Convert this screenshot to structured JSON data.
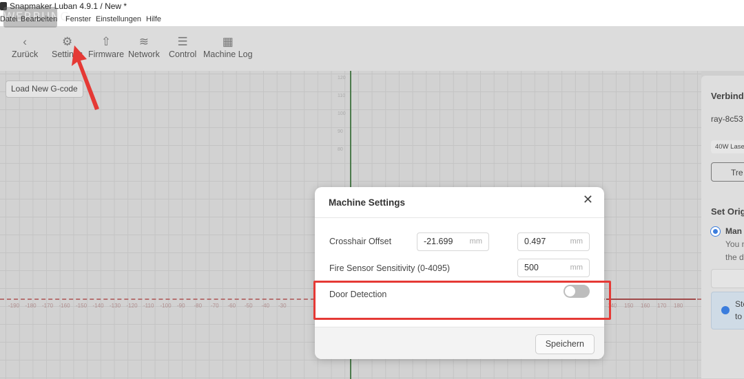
{
  "window": {
    "title": "Snapmaker Luban 4.9.1 / New *"
  },
  "menu": [
    "Datei",
    "Bearbeiten",
    "Fenster",
    "Einstellungen",
    "Hilfe"
  ],
  "watermark": "WERBUNG",
  "toolbar": [
    {
      "label": "Zurück",
      "icon": "chevron-left-icon",
      "glyph": "‹"
    },
    {
      "label": "Settings",
      "icon": "machine-settings-icon",
      "glyph": "⚙"
    },
    {
      "label": "Firmware",
      "icon": "firmware-upload-icon",
      "glyph": "⇧"
    },
    {
      "label": "Network",
      "icon": "wifi-icon",
      "glyph": "≋"
    },
    {
      "label": "Control",
      "icon": "sliders-icon",
      "glyph": "☰"
    },
    {
      "label": "Machine Log",
      "icon": "log-icon",
      "glyph": "▦"
    }
  ],
  "canvas": {
    "load_button": "Load New G-code",
    "x_ticks_left": [
      "-190",
      "-180",
      "-170",
      "-160",
      "-150",
      "-140",
      "-130",
      "-120",
      "-110",
      "-100",
      "-90",
      "-80",
      "-70",
      "-60",
      "-50",
      "-40",
      "-30"
    ],
    "x_ticks_right": [
      "140",
      "150",
      "160",
      "170",
      "180"
    ],
    "y_ticks": [
      "120",
      "110",
      "100",
      "90",
      "80"
    ],
    "axis_colors": {
      "x": "#a04848",
      "y": "#4c7a4c"
    }
  },
  "right_panel": {
    "connection_title": "Verbind",
    "device": "ray-8c53",
    "badge": "40W Lase",
    "disconnect_button": "Tre",
    "origin_title": "Set Orig",
    "radio_label": "Man",
    "radio_desc1": "You n",
    "radio_desc2": "the d",
    "info1": "Ste",
    "info2": "to"
  },
  "modal": {
    "title": "Machine Settings",
    "crosshair_label": "Crosshair Offset",
    "crosshair_x": "-21.699",
    "crosshair_y": "0.497",
    "unit": "mm",
    "fire_label": "Fire Sensor Sensitivity (0-4095)",
    "fire_value": "500",
    "door_label": "Door Detection",
    "door_enabled": false,
    "save_button": "Speichern"
  },
  "annotation_color": "#e53935"
}
